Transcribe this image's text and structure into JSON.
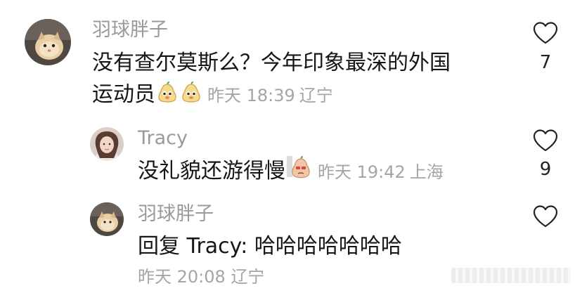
{
  "comments": [
    {
      "username": "羽球胖子",
      "text_line1": "没有查尔莫斯么？今年印象最深的外国",
      "text_line2": "运动员",
      "emoji": "pear-emoji",
      "time": "昨天 18:39",
      "location": "辽宁",
      "likes": "7"
    },
    {
      "username": "Tracy",
      "text": "没礼貌还游得慢",
      "emoji": "sad-pear-emoji",
      "time": "昨天 19:42",
      "location": "上海",
      "likes": "9"
    },
    {
      "username": "羽球胖子",
      "text": "回复 Tracy: 哈哈哈哈哈哈哈",
      "time": "昨天 20:08",
      "location": "辽宁",
      "likes": ""
    }
  ],
  "icons": {
    "like": "heart-outline-icon"
  }
}
